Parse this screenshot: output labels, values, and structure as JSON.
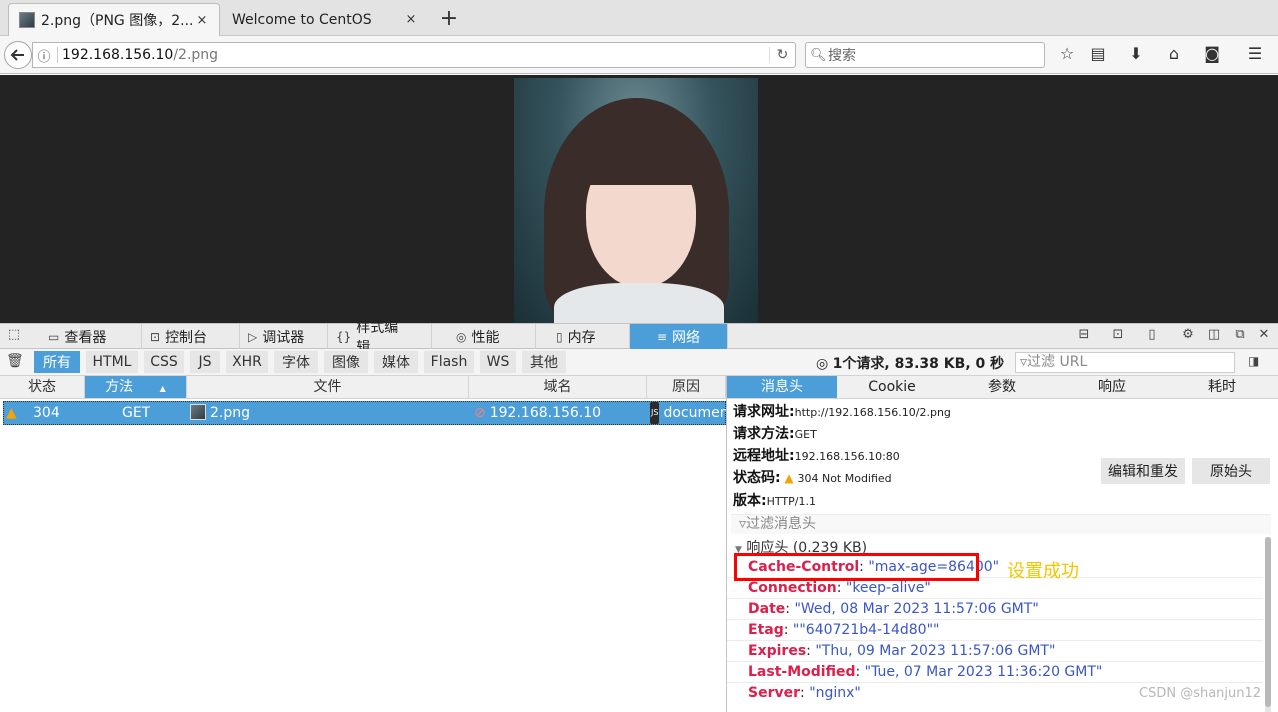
{
  "tabs": [
    {
      "title": "2.png（PNG 图像，2...",
      "close": "×",
      "active": true
    },
    {
      "title": "Welcome to CentOS",
      "close": "×",
      "active": false
    }
  ],
  "new_tab": "+",
  "nav": {
    "back_icon": "back-arrow-icon",
    "url_host": "192.168.156.10",
    "url_path": "/2.png",
    "reload": "↻",
    "search_placeholder": "搜索"
  },
  "devtools": {
    "tabs": [
      {
        "icon": "inspector-icon",
        "label": "查看器"
      },
      {
        "icon": "console-icon",
        "label": "控制台"
      },
      {
        "icon": "debugger-icon",
        "label": "调试器"
      },
      {
        "icon": "style-editor-icon",
        "label": "样式编辑..."
      },
      {
        "icon": "performance-icon",
        "label": "性能"
      },
      {
        "icon": "memory-icon",
        "label": "内存"
      },
      {
        "icon": "network-icon",
        "label": "网络",
        "active": true
      }
    ],
    "filters": [
      "所有",
      "HTML",
      "CSS",
      "JS",
      "XHR",
      "字体",
      "图像",
      "媒体",
      "Flash",
      "WS",
      "其他"
    ],
    "active_filter": "所有",
    "summary": {
      "count": "1个请求",
      "size": "83.38 KB",
      "time": "0 秒"
    },
    "url_filter_placeholder": "过滤 URL",
    "columns": [
      "状态",
      "方法",
      "文件",
      "域名",
      "原因"
    ],
    "request": {
      "status": "304",
      "method": "GET",
      "file": "2.png",
      "domain": "192.168.156.10",
      "cause": "document"
    },
    "detail_tabs": [
      "消息头",
      "Cookie",
      "参数",
      "响应",
      "耗时"
    ],
    "summary_fields": [
      {
        "key": "请求网址:",
        "value": "http://192.168.156.10/2.png"
      },
      {
        "key": "请求方法:",
        "value": "GET"
      },
      {
        "key": "远程地址:",
        "value": "192.168.156.10:80"
      },
      {
        "key": "状态码:",
        "value": "304  Not  Modified"
      },
      {
        "key": "版本:",
        "value": "HTTP/1.1"
      }
    ],
    "edit_resend": "编辑和重发",
    "raw_headers": "原始头",
    "header_filter_placeholder": "过滤消息头",
    "response_section": "响应头 (0.239 KB)",
    "response_headers": [
      {
        "name": "Cache-Control",
        "value": "\"max-age=86400\""
      },
      {
        "name": "Connection",
        "value": "\"keep-alive\""
      },
      {
        "name": "Date",
        "value": "\"Wed, 08 Mar 2023 11:57:06 GMT\""
      },
      {
        "name": "Etag",
        "value": "\"\"640721b4-14d80\"\""
      },
      {
        "name": "Expires",
        "value": "\"Thu, 09 Mar 2023 11:57:06 GMT\""
      },
      {
        "name": "Last-Modified",
        "value": "\"Tue, 07 Mar 2023 11:36:20 GMT\""
      },
      {
        "name": "Server",
        "value": "\"nginx\""
      }
    ],
    "annotation": "设置成功",
    "watermark": "CSDN @shanjun12"
  },
  "colors": {
    "accent": "#4c9ed9",
    "header_key": "#dd1f4b",
    "header_value": "#3a56c5",
    "highlight": "#ff0000",
    "note": "#f3c600"
  }
}
